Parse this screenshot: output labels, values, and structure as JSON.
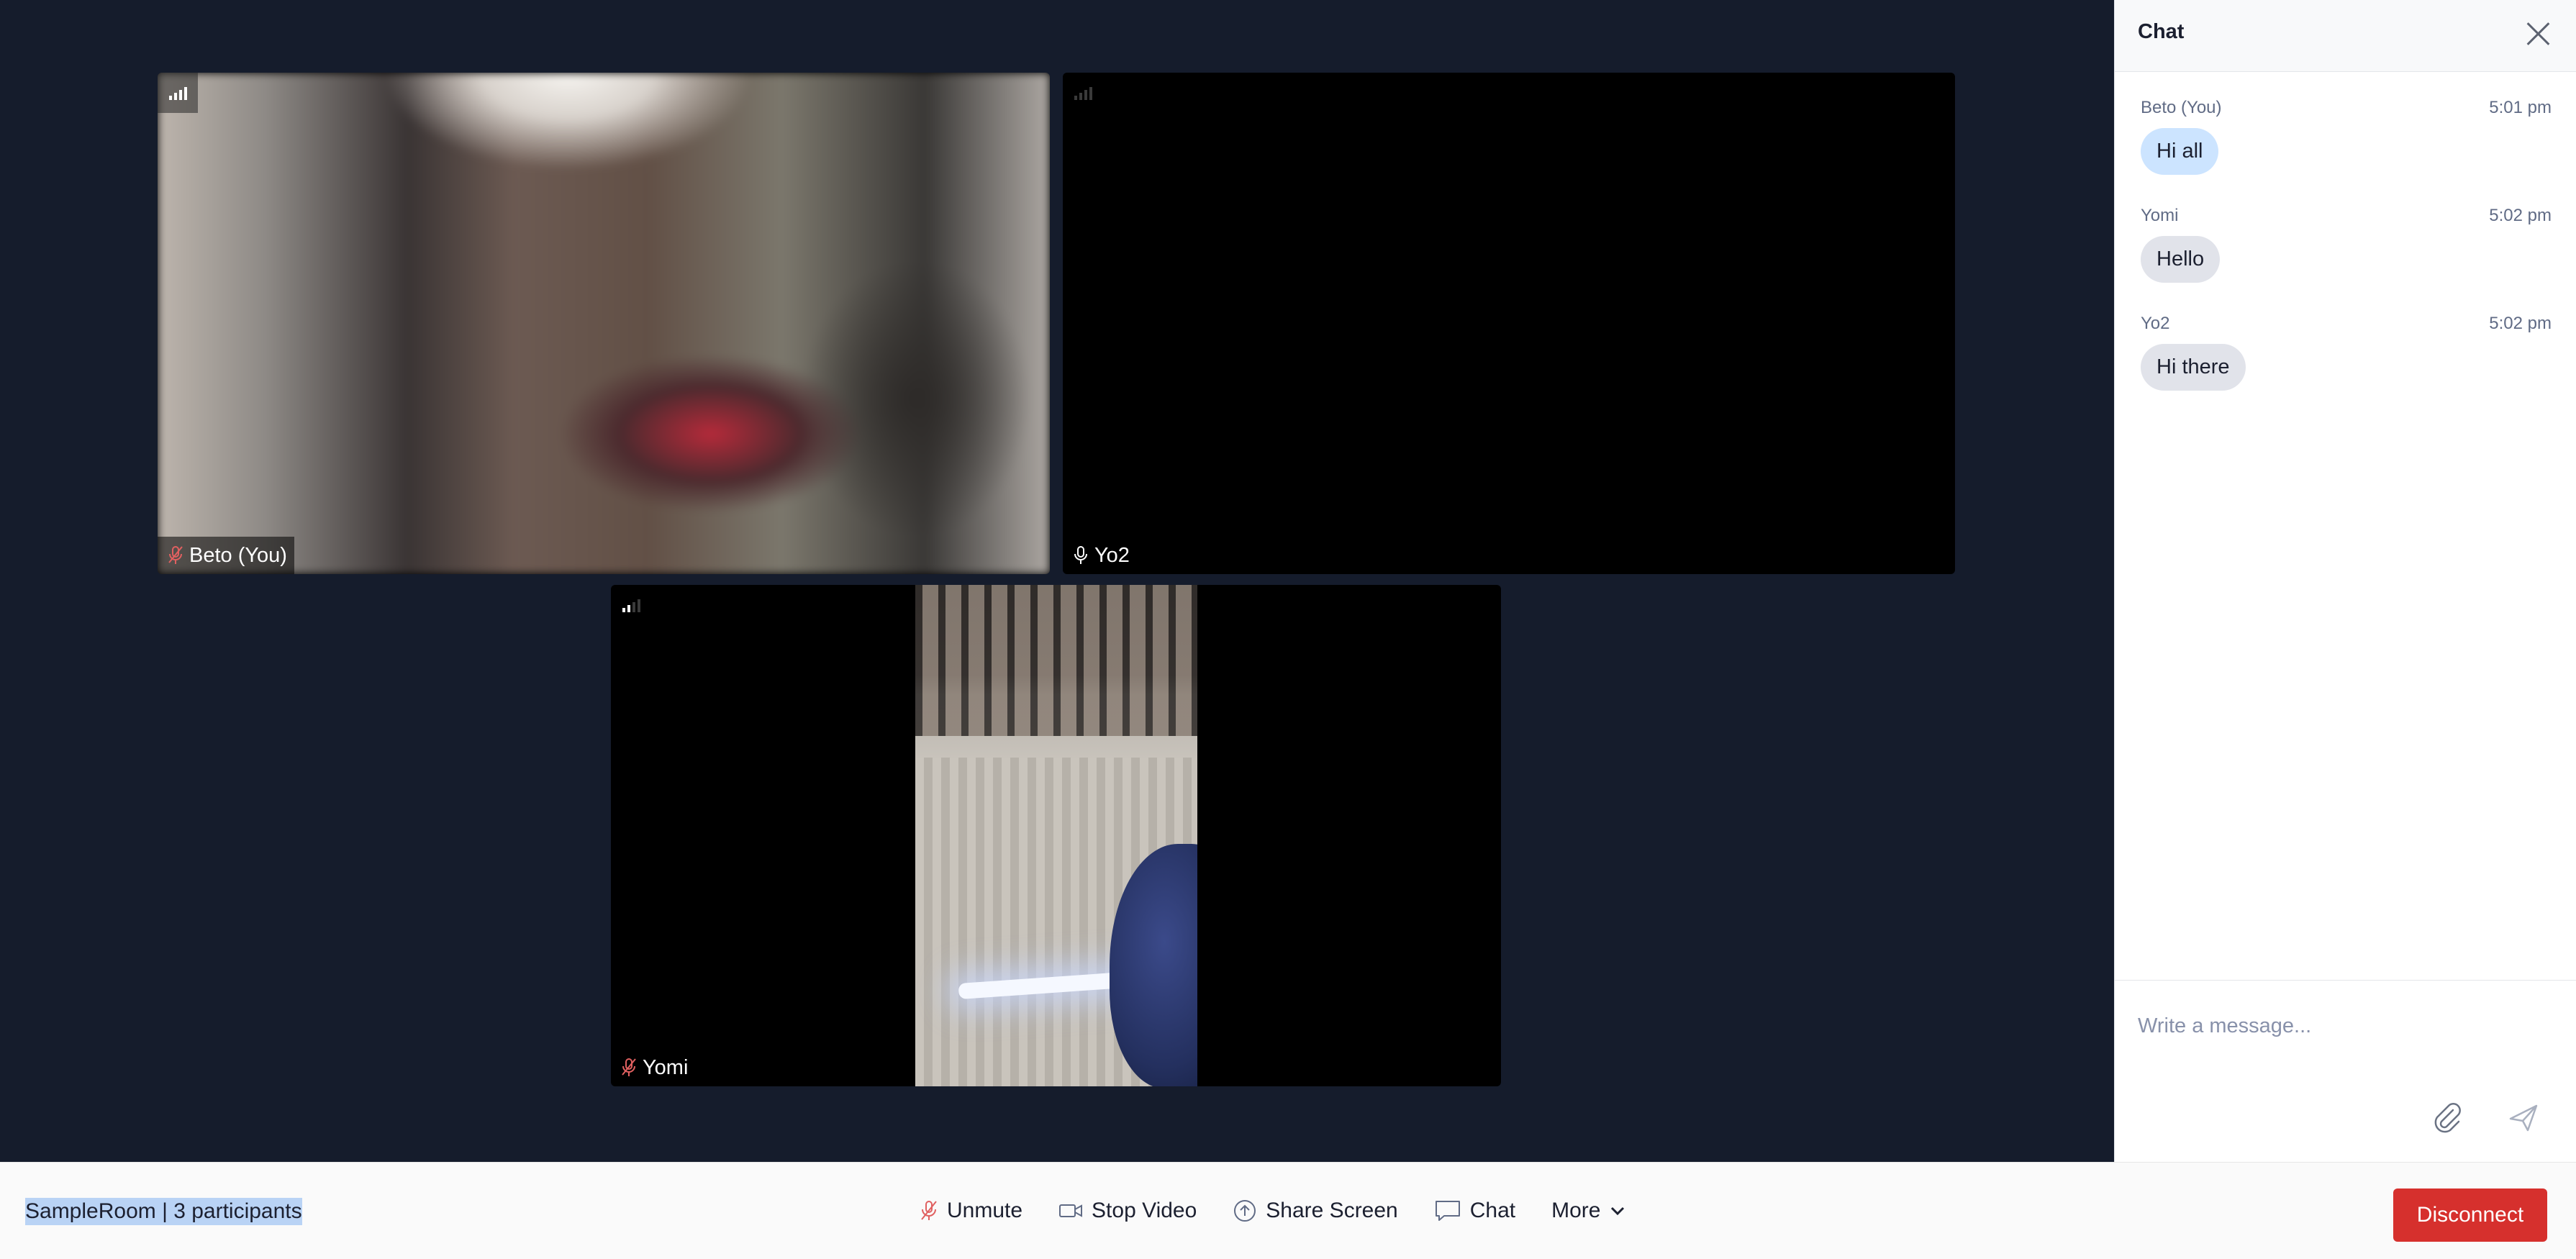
{
  "participants": [
    {
      "name": "Beto (You)",
      "mic": "mic-icon",
      "video": "blurred camera feed"
    },
    {
      "name": "Yo2",
      "mic": "mic-icon",
      "video": "camera off"
    },
    {
      "name": "Yomi",
      "mic": "mic-icon",
      "video": "portrait phone camera"
    }
  ],
  "chat": {
    "title": "Chat",
    "messages": [
      {
        "author": "Beto (You)",
        "time": "5:01 pm",
        "text": "Hi all"
      },
      {
        "author": "Yomi",
        "time": "5:02 pm",
        "text": "Hello"
      },
      {
        "author": "Yo2",
        "time": "5:02 pm",
        "text": "Hi there"
      }
    ],
    "input_placeholder": "Write a message...",
    "icons": [
      "close-icon",
      "paperclip-icon",
      "send-icon"
    ]
  },
  "toolbar": {
    "room_info": "SampleRoom | 3 participants",
    "unmute_label": "Unmute",
    "stop_video_label": "Stop Video",
    "share_screen_label": "Share Screen",
    "chat_label": "Chat",
    "more_label": "More",
    "disconnect_label": "Disconnect"
  },
  "colors": {
    "stage_bg": "#151c2c",
    "disconnect": "#d6302d",
    "own_bubble": "#cce4ff",
    "other_bubble": "#e1e3ea",
    "muted_mic": "#e06060"
  }
}
